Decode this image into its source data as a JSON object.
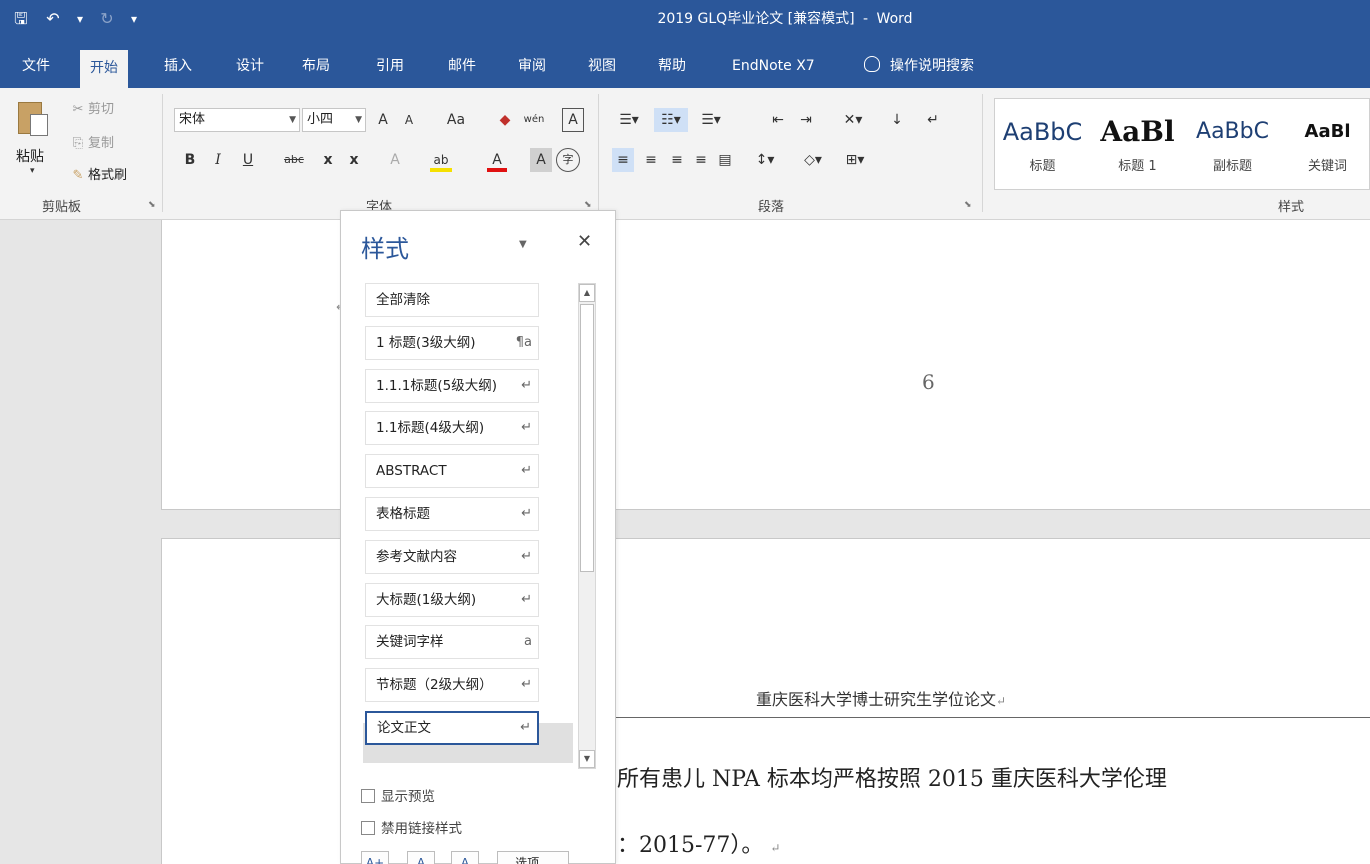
{
  "window": {
    "title": "2019 GLQ毕业论文 [兼容模式]",
    "separator": "-",
    "app": "Word"
  },
  "qat": {
    "save": "🖫",
    "undo": "↶",
    "undo_dd": "▾",
    "redo": "↻",
    "customize": "▾"
  },
  "tabs": [
    "文件",
    "开始",
    "插入",
    "设计",
    "布局",
    "引用",
    "邮件",
    "审阅",
    "视图",
    "帮助",
    "EndNote X7"
  ],
  "tell_me": "操作说明搜索",
  "clipboard": {
    "paste": "粘贴",
    "paste_dd": "▾",
    "cut": "剪切",
    "copy": "复制",
    "format_painter": "格式刷",
    "group": "剪贴板"
  },
  "font": {
    "name": "宋体",
    "size": "小四",
    "grow": "A",
    "shrink": "A",
    "case": "Aa",
    "clear": "◆",
    "phonetic": "wén",
    "border_char": "A",
    "bold": "B",
    "italic": "I",
    "underline": "U",
    "strike": "abc",
    "sub": "x",
    "sup": "x",
    "effects": "A",
    "highlight": "ab",
    "font_color": "A",
    "shade": "A",
    "enclose": "字",
    "group": "字体",
    "highlight_color": "#f5e000",
    "font_color_value": "#e01010"
  },
  "paragraph": {
    "group": "段落"
  },
  "styles_group": {
    "group": "样式",
    "tiles": [
      {
        "sample": "AaBbC",
        "name": "标题"
      },
      {
        "sample": "AaBl",
        "name": "标题 1"
      },
      {
        "sample": "AaBbC",
        "name": "副标题"
      },
      {
        "sample": "AaBl",
        "name": "关键词"
      }
    ]
  },
  "styles_pane": {
    "title": "样式",
    "items": [
      {
        "label": "全部清除",
        "mark": ""
      },
      {
        "label": "1 标题(3级大纲)",
        "mark": "¶a"
      },
      {
        "label": "1.1.1标题(5级大纲)",
        "mark": "↵"
      },
      {
        "label": "1.1标题(4级大纲)",
        "mark": "↵"
      },
      {
        "label": "ABSTRACT",
        "mark": "↵"
      },
      {
        "label": "表格标题",
        "mark": "↵"
      },
      {
        "label": "参考文献内容",
        "mark": "↵"
      },
      {
        "label": "大标题(1级大纲)",
        "mark": "↵"
      },
      {
        "label": "关键词字样",
        "mark": "a"
      },
      {
        "label": "节标题（2级大纲）",
        "mark": "↵"
      },
      {
        "label": "论文正文",
        "mark": "↵"
      }
    ],
    "show_preview": "显示预览",
    "disable_linked": "禁用链接样式",
    "options": "选项..."
  },
  "document": {
    "page_number": "6",
    "header": "重庆医科大学博士研究生学位论文",
    "line1": "所有患儿 NPA 标本均严格按照 2015 重庆医科大学伦理",
    "line2": "：2015-77）。",
    "para_mark": "↵"
  },
  "colors": {
    "accent": "#2b579a",
    "ribbon": "#f3f3f3"
  }
}
